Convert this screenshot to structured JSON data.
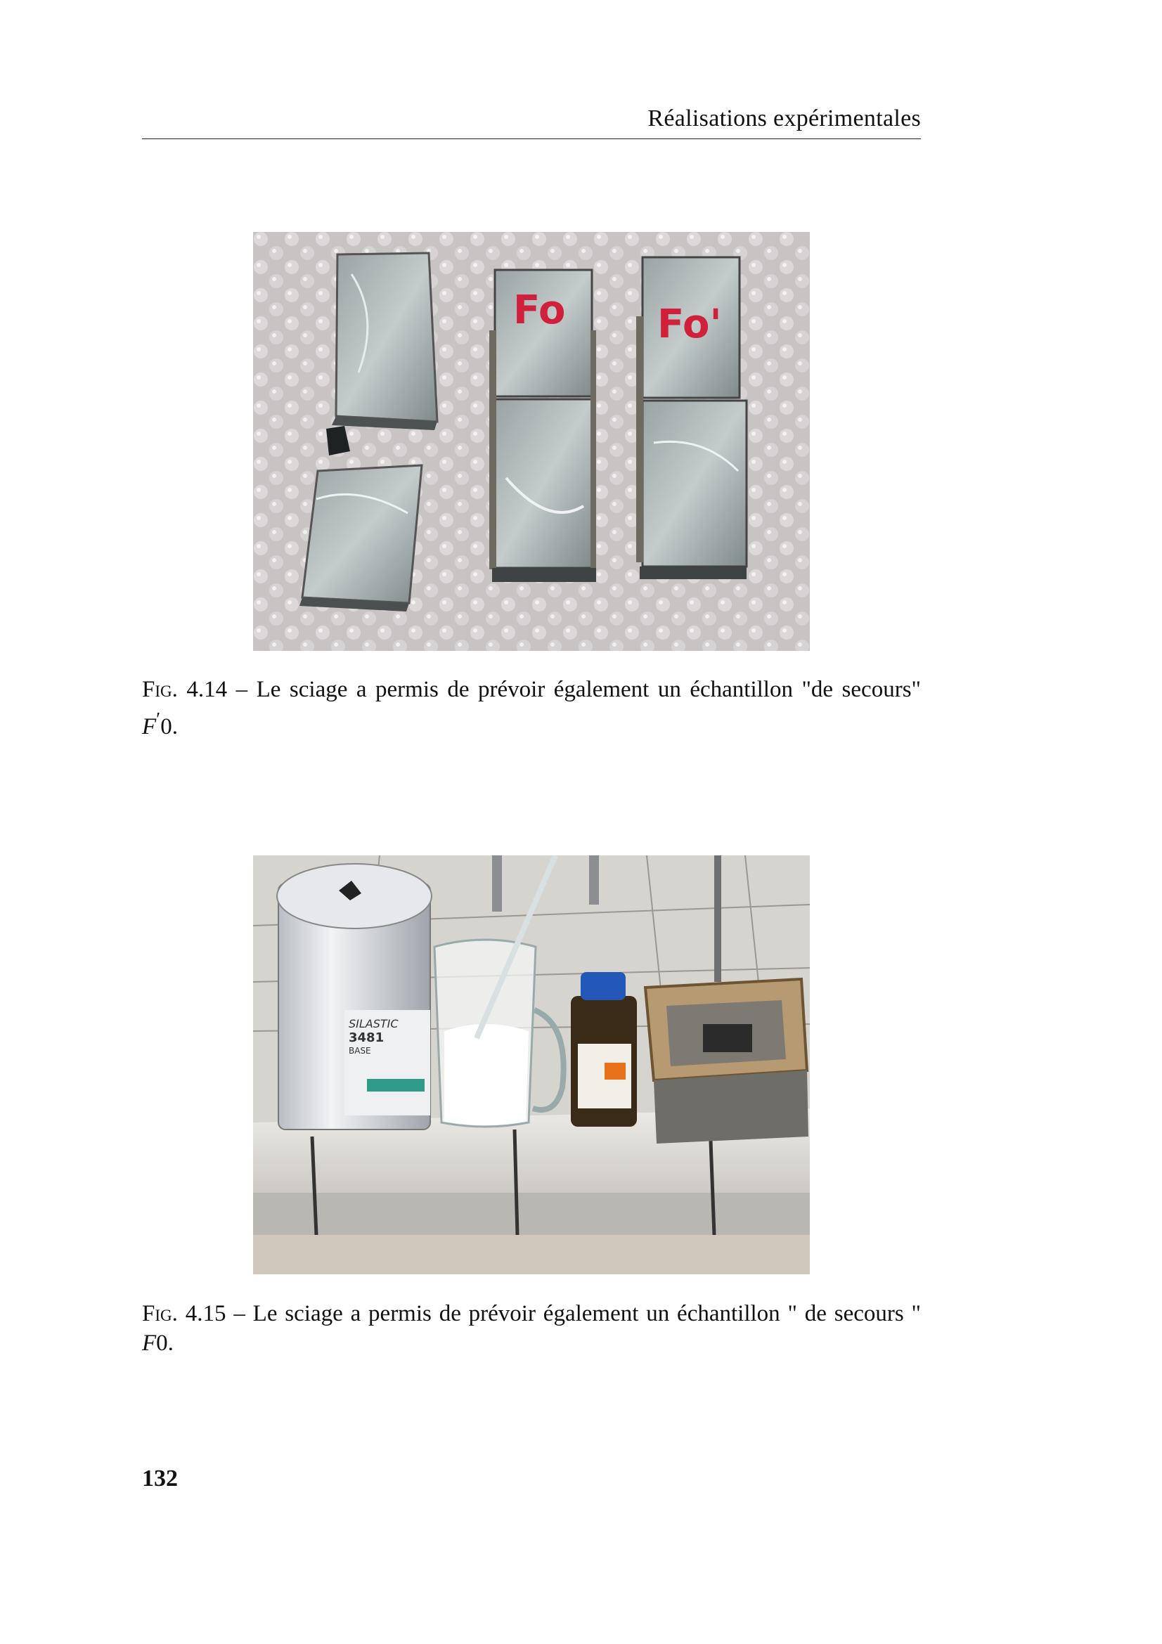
{
  "header": {
    "running_title": "Réalisations expérimentales"
  },
  "figures": [
    {
      "label": "Fig.",
      "number": "4.14",
      "dash": "–",
      "caption_text": "Le sciage a permis de prévoir également un échantillon \"de secours\"",
      "caption_math_main": "F",
      "caption_math_prime": "′",
      "caption_math_tail": "0.",
      "photo_marks": [
        "Fo",
        "Fo'"
      ]
    },
    {
      "label": "Fig.",
      "number": "4.15",
      "dash": "–",
      "caption_text": "Le sciage a permis de prévoir également un échantillon \" de secours \"",
      "caption_math_main": "F",
      "caption_math_tail": "0.",
      "photo_labels": [
        "SILASTIC",
        "3481",
        "BASE"
      ]
    }
  ],
  "footer": {
    "page_number": "132"
  }
}
